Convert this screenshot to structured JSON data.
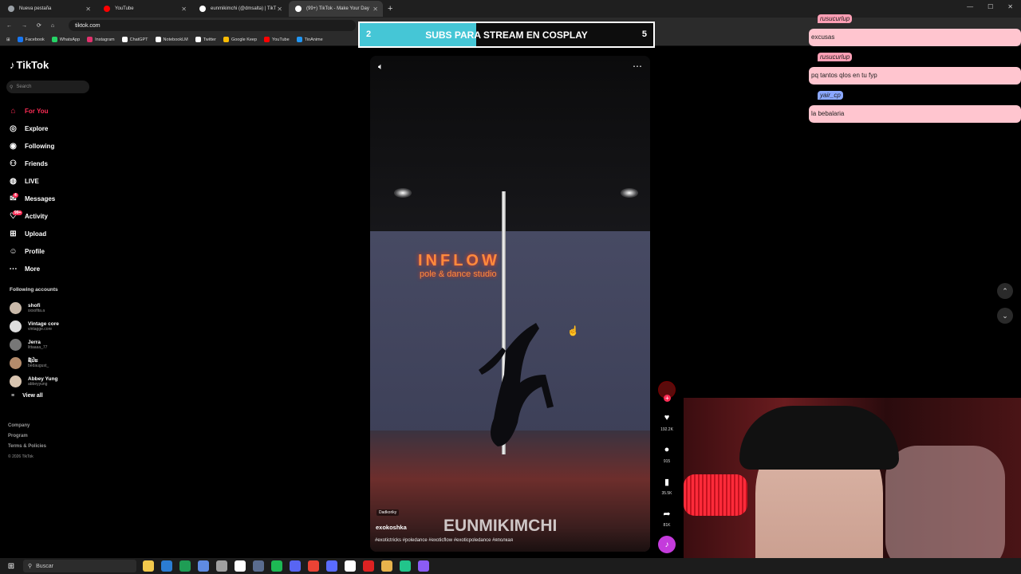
{
  "browser": {
    "tabs": [
      {
        "title": "Nueva pestaña",
        "active": false,
        "color": "#9aa0a6"
      },
      {
        "title": "YouTube",
        "active": false,
        "color": "#ff0000"
      },
      {
        "title": "eunmikimchi (@dmsalta) | TikT",
        "active": false,
        "color": "#ffffff"
      },
      {
        "title": "(99+) TikTok - Make Your Day",
        "active": true,
        "color": "#ffffff"
      }
    ],
    "new_tab": "+",
    "url": "tiktok.com",
    "bookmarks": [
      {
        "label": "Facebook",
        "color": "#1877f2"
      },
      {
        "label": "WhatsApp",
        "color": "#25d366"
      },
      {
        "label": "Instagram",
        "color": "#e1306c"
      },
      {
        "label": "ChatGPT",
        "color": "#ffffff"
      },
      {
        "label": "NotebookLM",
        "color": "#ffffff"
      },
      {
        "label": "Twitter",
        "color": "#ffffff"
      },
      {
        "label": "Google Keep",
        "color": "#fbbc04"
      },
      {
        "label": "YouTube",
        "color": "#ff0000"
      },
      {
        "label": "TioAnime",
        "color": "#2196f3"
      }
    ]
  },
  "sub_goal": {
    "current": "2",
    "label": "SUBS PARA STREAM EN COSPLAY",
    "target": "5",
    "progress_fraction": 0.4,
    "fill_color": "#45c6d6"
  },
  "tiktok": {
    "logo": "TikTok",
    "search_placeholder": "Search",
    "nav": [
      {
        "label": "For You",
        "icon": "home-icon",
        "glyph": "⌂",
        "active": true
      },
      {
        "label": "Explore",
        "icon": "compass-icon",
        "glyph": "◎"
      },
      {
        "label": "Following",
        "icon": "following-icon",
        "glyph": "◉"
      },
      {
        "label": "Friends",
        "icon": "friends-icon",
        "glyph": "⚇"
      },
      {
        "label": "LIVE",
        "icon": "live-icon",
        "glyph": "◍"
      },
      {
        "label": "Messages",
        "icon": "messages-icon",
        "glyph": "✉",
        "badge": "4"
      },
      {
        "label": "Activity",
        "icon": "activity-icon",
        "glyph": "♡",
        "badge": "99+"
      },
      {
        "label": "Upload",
        "icon": "upload-icon",
        "glyph": "⊞"
      },
      {
        "label": "Profile",
        "icon": "profile-icon",
        "glyph": "☺"
      },
      {
        "label": "More",
        "icon": "more-icon",
        "glyph": "⋯"
      }
    ],
    "following_title": "Following accounts",
    "following": [
      {
        "name": "shofi",
        "handle": "sxsofita.a"
      },
      {
        "name": "Vintage core",
        "handle": "vintagge.core"
      },
      {
        "name": "Jerra",
        "handle": "littaaaa_77"
      },
      {
        "name": "ຊ໌ປ່ະ",
        "handle": "bedaugust_"
      },
      {
        "name": "Abbey Yung",
        "handle": "abbeyyung"
      }
    ],
    "view_all": "View all",
    "footer": [
      "Company",
      "Program",
      "Terms & Policies"
    ],
    "copyright": "© 2026 TikTok"
  },
  "video": {
    "neon_line1": "INFLOW",
    "neon_line2": "pole & dance studio",
    "tag": "Dadkoriky",
    "author": "exokoshka",
    "caption": "#exotictricks #poledance #exoticflow #exoticpoledance #яполкая",
    "watermark": "EUNMIKIMCHI",
    "likes": "192.2K",
    "comments": "915",
    "saves": "35.5K",
    "shares": "81K"
  },
  "chat": [
    {
      "user": "rusucurlup",
      "text": "excusas",
      "color": "#ff9fb5"
    },
    {
      "user": "rusucurlup",
      "text": "pq tantos qlos en tu fyp",
      "color": "#ff9fb5"
    },
    {
      "user": "yair_cp",
      "text": "la bebalaria",
      "color": "#8aa7ff"
    }
  ],
  "taskbar": {
    "search_placeholder": "Buscar",
    "icons": [
      "#f2c94c",
      "#2b7cd3",
      "#1f9d55",
      "#5f8be3",
      "#a0a0a0",
      "#ffffff",
      "#5a6c8f",
      "#1db954",
      "#5865f2",
      "#ea4335",
      "#5a6cff",
      "#ffffff",
      "#d22",
      "#e7b34c",
      "#22c58b",
      "#8b5cf6"
    ]
  }
}
